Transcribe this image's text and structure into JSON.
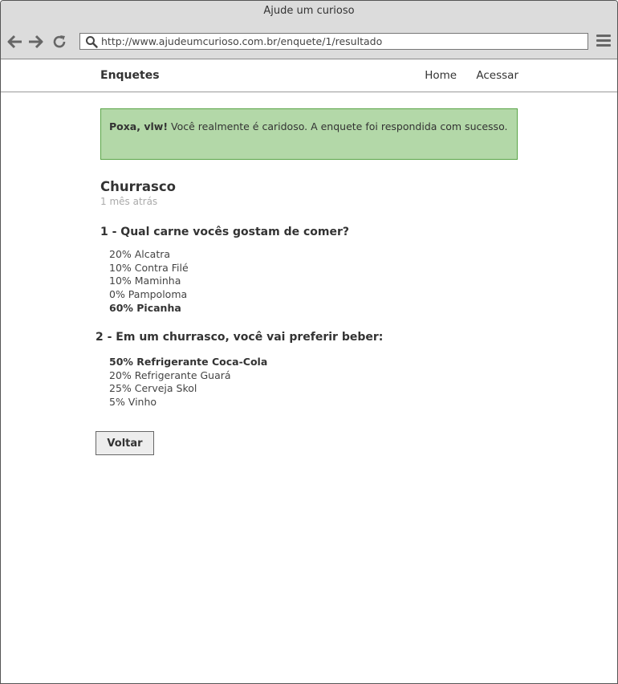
{
  "window": {
    "title": "Ajude um curioso"
  },
  "browser": {
    "url": "http://www.ajudeumcurioso.com.br/enquete/1/resultado"
  },
  "nav": {
    "brand": "Enquetes",
    "links": [
      "Home",
      "Acessar"
    ]
  },
  "alert": {
    "strong": "Poxa, vlw!",
    "message": " Você realmente é caridoso. A enquete foi respondida com sucesso."
  },
  "poll": {
    "title": "Churrasco",
    "time": "1 mês atrás",
    "questions": [
      {
        "label": "1 - Qual carne vocês gostam de comer?",
        "options": [
          {
            "text": "20% Alcatra"
          },
          {
            "text": "10% Contra Filé"
          },
          {
            "text": "10% Maminha"
          },
          {
            "text": "0% Pampoloma"
          },
          {
            "text": "60% Picanha"
          }
        ]
      },
      {
        "label": "2 - Em um churrasco, você vai preferir beber:",
        "options": [
          {
            "text": "50% Refrigerante Coca-Cola"
          },
          {
            "text": "20% Refrigerante Guará"
          },
          {
            "text": "25% Cerveja Skol"
          },
          {
            "text": "5% Vinho"
          }
        ]
      }
    ]
  },
  "back_button": "Voltar"
}
